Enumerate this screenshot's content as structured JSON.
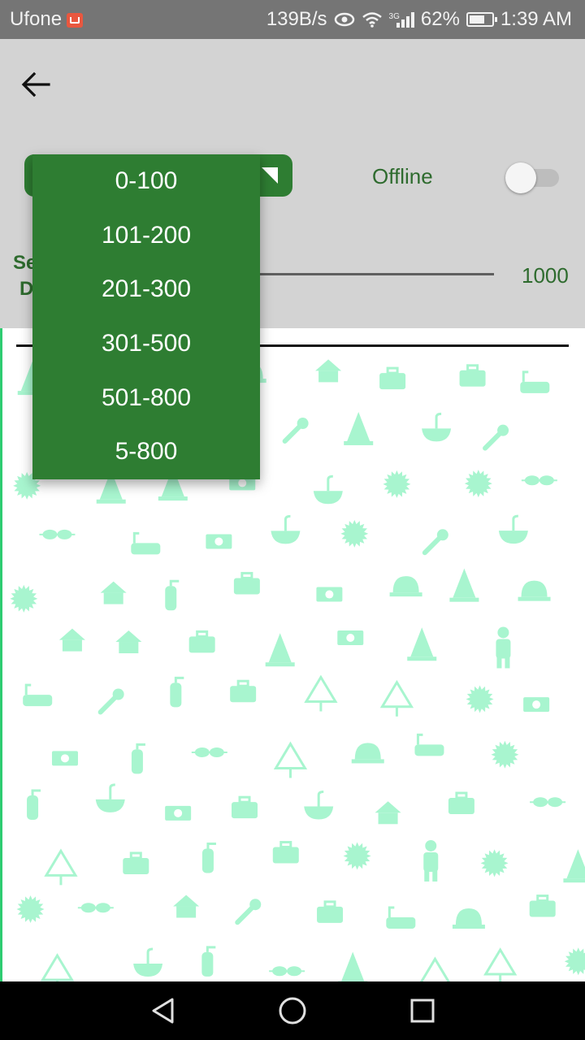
{
  "status_bar": {
    "carrier": "Ufone",
    "net_speed": "139B/s",
    "network_type": "3G",
    "battery": "62%",
    "time": "1:39 AM",
    "text_color": "#f2f2f2",
    "background": "#757575"
  },
  "app": {
    "accent_green": "#2e7d32",
    "label_green": "#2e6b2e",
    "header_background": "#d3d3d3",
    "back_icon": "arrow-left-icon",
    "spinner_icon": "dropdown-triangle-icon",
    "offline_label": "Offline",
    "offline_toggle_on": false,
    "partial_label_line1": "Se",
    "partial_label_line2": "D",
    "slider_value": "1000"
  },
  "dropdown": {
    "options": [
      "0-100",
      "101-200",
      "201-300",
      "301-500",
      "501-800",
      "5-800"
    ]
  },
  "pattern": {
    "color": "#a8f5cf",
    "icons": [
      "worker-icon",
      "cone-icon",
      "toolbox-icon",
      "wrench-icon",
      "sink-icon",
      "saw-blade-icon",
      "house-icon",
      "warning-sign-icon",
      "money-icon",
      "goggles-icon",
      "helmet-icon",
      "extinguisher-icon",
      "bathtub-icon"
    ]
  },
  "nav_bar": {
    "icons": [
      "back-triangle-icon",
      "home-circle-icon",
      "recents-square-icon"
    ]
  }
}
